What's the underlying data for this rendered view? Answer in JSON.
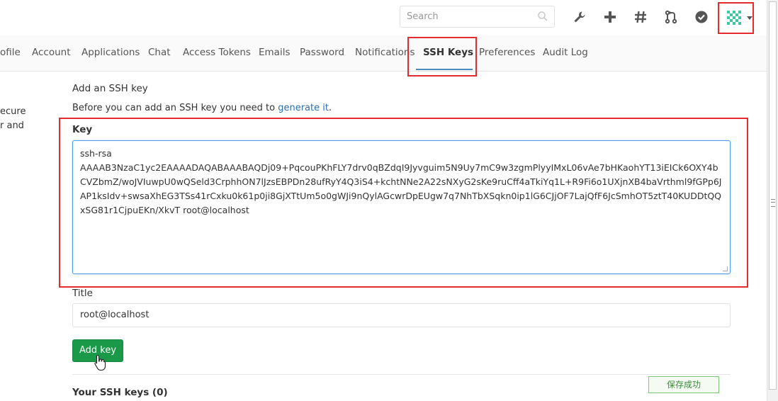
{
  "header": {
    "search_placeholder": "Search",
    "icons": [
      "wrench-icon",
      "plus-icon",
      "hash-icon",
      "merge-request-icon",
      "todo-check-icon",
      "user-avatar"
    ]
  },
  "profile_nav": {
    "tabs": [
      {
        "label": "ofile"
      },
      {
        "label": "Account"
      },
      {
        "label": "Applications"
      },
      {
        "label": "Chat"
      },
      {
        "label": "Access Tokens"
      },
      {
        "label": "Emails"
      },
      {
        "label": "Password"
      },
      {
        "label": "Notifications"
      },
      {
        "label": "SSH Keys",
        "active": true
      },
      {
        "label": "Preferences"
      },
      {
        "label": "Audit Log"
      }
    ]
  },
  "sidebar_fragment": {
    "line1": "ecure",
    "line2": "r and"
  },
  "form": {
    "section_title": "Add an SSH key",
    "intro_text": "Before you can add an SSH key you need to ",
    "intro_link": "generate it",
    "intro_end": ".",
    "key_label": "Key",
    "key_value": "ssh-rsa AAAAB3NzaC1yc2EAAAADAQABAAABAQDj09+PqcouPKhFLY7drv0qBZdqI9Jyvguim5N9Uy7mC9w3zgmPlyyIMxL06vAe7bHKaohYT13iEICk6OXY4bCVZbmZ/woJVIuwpU0wQSeld3CrphhON7lJzsEBPDn28ufRyY4Q3iS4+kchtNNe2A22sNXyG2sKe9ruCff4aTkiYq1L+R9Fi6o1UXjnXB4baVrthml9fGPp6JAP1ksIdv+swsaXhEG3TSs41rCxku0k61p0ji8GjXTtUm5o0gWJi9nQylAGcwrDpEUgw7q7NhTbXSqkn0ip1lG6CJjOF7LajQfF6JcSmhOT5ztT40KUDDtQQxSG81r1CjpuEKn/XkvT root@localhost",
    "key_lines": [
      "ssh-rsa",
      "AAAAB3NzaC1yc2EAAAADAQABAAABAQDj09+PqcouPKhFLY7drv0qBZdqI9Jyvguim5N9Uy7mC9w3zgmPlyyIMxL06vAe7bHKaohYT13iEICk6OXY4b",
      "CVZbmZ/woJVIuwpU0wQSeld3CrphhON7lJzsEBPDn28ufRyY4Q3iS4+kchtNNe2A22sNXyG2sKe9ruCff4aTkiYq1L+R9Fi6o1UXjnXB4baVrthml9fGPp6J",
      "AP1ksIdv+swsaXhEG3TSs41rCxku0k61p0ji8GjXTtUm5o0gWJi9nQylAGcwrDpEUgw7q7NhTbXSqkn0ip1lG6CJjOF7LajQfF6JcSmhOT5ztT40KUDDtQQ",
      "xSG81r1CjpuEKn/XkvT root@localhost"
    ],
    "title_label": "Title",
    "title_value": "root@localhost",
    "submit_label": "Add key"
  },
  "keys_list": {
    "heading": "Your SSH keys (0)"
  },
  "toast": {
    "message": "保存成功"
  },
  "colors": {
    "highlight_red": "#e52b2b",
    "active_tab_underline": "#4a8bc2",
    "button_green": "#1a9948",
    "link_blue": "#2b6fb0",
    "textarea_focus": "#4f9de8"
  }
}
